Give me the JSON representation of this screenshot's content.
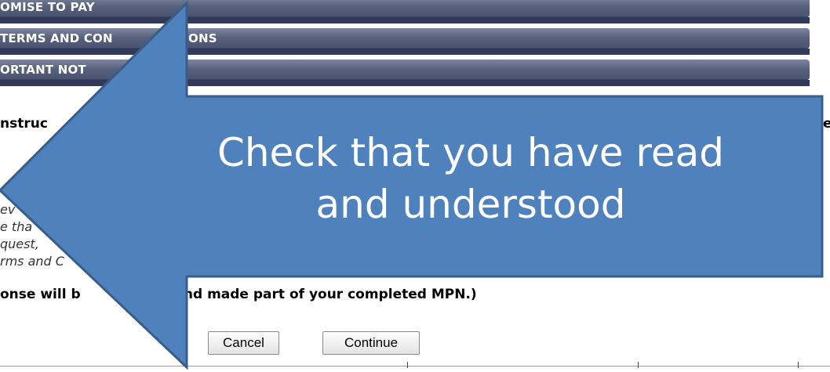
{
  "sections": [
    {
      "label": "OMISE TO PAY"
    },
    {
      "label": "TERMS AND CON"
    },
    {
      "label": "ORTANT NOT"
    }
  ],
  "sections_visible_tail": {
    "terms_tail": "ONS"
  },
  "instructions": {
    "heading_start": "nstruc",
    "heading_end": "e"
  },
  "italic_fragments": [
    "ev",
    "e tha",
    "quest,",
    "rms and C"
  ],
  "response": {
    "part1": "onse will b",
    "part2": "ded and made part of your completed MPN.)"
  },
  "buttons": {
    "cancel": "Cancel",
    "continue": "Continue"
  },
  "callout": {
    "line1": "Check that you have read",
    "line2": "and understood",
    "fill": "#4f81bd",
    "stroke": "#385d8a"
  },
  "colors": {
    "bar": "#58627d",
    "bar_band": "#313a5a"
  }
}
